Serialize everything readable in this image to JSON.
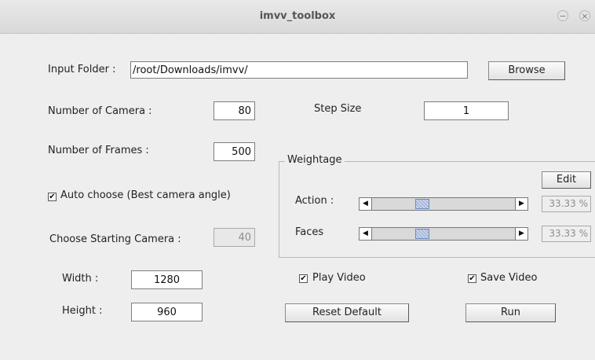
{
  "window": {
    "title": "imvv_toolbox",
    "minimize_glyph": "−",
    "close_glyph": "×"
  },
  "input_folder": {
    "label": "Input Folder :",
    "value": "/root/Downloads/imvv/",
    "browse_label": "Browse"
  },
  "num_camera": {
    "label": "Number of Camera :",
    "value": "80"
  },
  "step_size": {
    "label": "Step Size",
    "value": "1"
  },
  "num_frames": {
    "label": "Number of Frames :",
    "value": "500"
  },
  "auto_choose": {
    "label": "Auto choose (Best camera angle)",
    "checked": true
  },
  "starting_camera": {
    "label": "Choose Starting Camera :",
    "value": "40"
  },
  "weightage": {
    "title": "Weightage",
    "edit_label": "Edit",
    "action": {
      "label": "Action :",
      "percent_text": "33.33 %",
      "level": 0.3333
    },
    "faces": {
      "label": "Faces",
      "percent_text": "33.33 %",
      "level": 0.3333
    }
  },
  "width": {
    "label": "Width :",
    "value": "1280"
  },
  "height": {
    "label": "Height :",
    "value": "960"
  },
  "play_video": {
    "label": "Play Video",
    "checked": true
  },
  "save_video": {
    "label": "Save Video",
    "checked": true
  },
  "reset_label": "Reset Default",
  "run_label": "Run",
  "icons": {
    "checkmark": "✔",
    "arrow_left": "◀",
    "arrow_right": "▶"
  }
}
